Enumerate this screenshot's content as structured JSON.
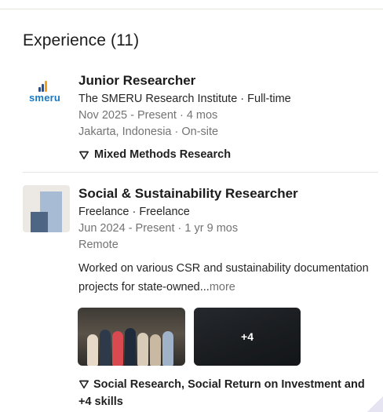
{
  "section": {
    "title": "Experience (11)"
  },
  "experiences": [
    {
      "logo": {
        "icon": "smeru-logo",
        "wordmark": "smeru"
      },
      "title": "Junior Researcher",
      "company_line": "The SMERU Research Institute · Full-time",
      "dates": "Nov 2025 - Present · 4 mos",
      "location": "Jakarta, Indonesia · On-site",
      "skills": "Mixed Methods Research"
    },
    {
      "logo": {
        "icon": "freelance-logo"
      },
      "title": "Social & Sustainability Researcher",
      "company_line": "Freelance · Freelance",
      "dates": "Jun 2024 - Present · 1 yr 9 mos",
      "location": "Remote",
      "description": "Worked on various CSR and sustainability documentation projects for state-owned...",
      "more_label": "more",
      "media_more": "+4",
      "skills": "Social Research, Social Return on Investment and +4 skills"
    }
  ],
  "colors": {
    "accent_blue": "#1a78c2",
    "muted_text": "#737373",
    "divider": "#e8e6e2"
  }
}
